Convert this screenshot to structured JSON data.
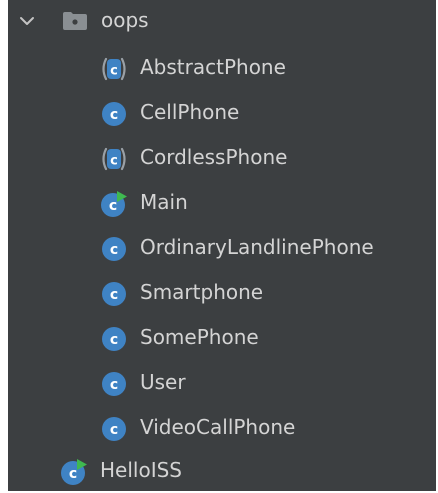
{
  "tree": {
    "folder": {
      "label": "oops",
      "expanded": true,
      "icon": "package-folder-icon"
    },
    "children": [
      {
        "label": "AbstractPhone",
        "kind": "abstract-class",
        "icon": "abstract-class-icon"
      },
      {
        "label": "CellPhone",
        "kind": "class",
        "icon": "class-icon"
      },
      {
        "label": "CordlessPhone",
        "kind": "abstract-class",
        "icon": "abstract-class-icon"
      },
      {
        "label": "Main",
        "kind": "runnable-class",
        "icon": "runnable-class-icon"
      },
      {
        "label": "OrdinaryLandlinePhone",
        "kind": "class",
        "icon": "class-icon"
      },
      {
        "label": "Smartphone",
        "kind": "class",
        "icon": "class-icon"
      },
      {
        "label": "SomePhone",
        "kind": "class",
        "icon": "class-icon"
      },
      {
        "label": "User",
        "kind": "class",
        "icon": "class-icon"
      },
      {
        "label": "VideoCallPhone",
        "kind": "class",
        "icon": "class-icon"
      }
    ],
    "sibling": {
      "label": "HelloISS",
      "kind": "runnable-class",
      "icon": "runnable-class-icon"
    }
  },
  "colors": {
    "panel_background": "#3c3f41",
    "text": "#d4d4d4",
    "class_icon": "#3f83c4",
    "run_marker": "#3fb950",
    "folder": "#8a8f93"
  }
}
